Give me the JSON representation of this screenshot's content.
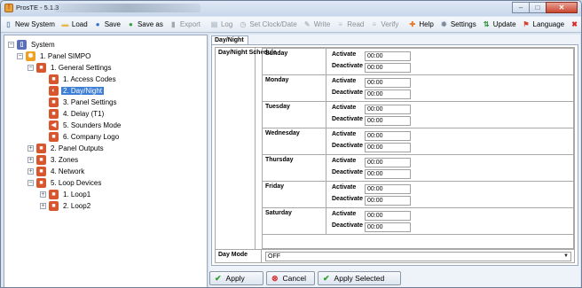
{
  "window": {
    "title": "ProsTE - 5.1.3",
    "controls": {
      "minimize": "–",
      "maximize": "□",
      "close": "✕"
    }
  },
  "toolbar": {
    "items": [
      {
        "label": "New System",
        "icon": "new-file-icon",
        "glyph": "▯",
        "color": "#6a87b6",
        "enabled": true
      },
      {
        "label": "Load",
        "icon": "folder-icon",
        "glyph": "▬",
        "color": "#e6b84a",
        "enabled": true
      },
      {
        "label": "Save",
        "icon": "save-disk-icon",
        "glyph": "●",
        "color": "#2c6fcf",
        "enabled": true
      },
      {
        "label": "Save as",
        "icon": "save-as-icon",
        "glyph": "●",
        "color": "#3a9f3a",
        "enabled": true
      },
      {
        "label": "Export",
        "icon": "export-chart-icon",
        "glyph": "▮",
        "color": "#a0a8b4",
        "enabled": false
      },
      {
        "label": "Log",
        "icon": "log-icon",
        "glyph": "▤",
        "color": "#b6bfcc",
        "enabled": false
      },
      {
        "label": "Set Clock/Date",
        "icon": "clock-icon",
        "glyph": "◷",
        "color": "#b6bfcc",
        "enabled": false
      },
      {
        "label": "Write",
        "icon": "pencil-icon",
        "glyph": "✎",
        "color": "#b6bfcc",
        "enabled": false
      },
      {
        "label": "Read",
        "icon": "read-icon",
        "glyph": "≡",
        "color": "#b6bfcc",
        "enabled": false
      },
      {
        "label": "Verify",
        "icon": "verify-icon",
        "glyph": "≡",
        "color": "#b6bfcc",
        "enabled": false
      },
      {
        "label": "Help",
        "icon": "help-lifebuoy-icon",
        "glyph": "✚",
        "color": "#e87a2c",
        "enabled": true
      },
      {
        "label": "Settings",
        "icon": "gear-icon",
        "glyph": "✹",
        "color": "#7a8a9a",
        "enabled": true
      },
      {
        "label": "Update",
        "icon": "update-arrows-icon",
        "glyph": "⇅",
        "color": "#2f8f3a",
        "enabled": true
      },
      {
        "label": "Language",
        "icon": "language-flag-icon",
        "glyph": "⚑",
        "color": "#d4442b",
        "enabled": true
      },
      {
        "label": "Exit",
        "icon": "exit-x-icon",
        "glyph": "✖",
        "color": "#d42b2b",
        "enabled": true
      }
    ]
  },
  "tree": {
    "nodes": [
      {
        "label": "System",
        "level": 0,
        "expander": "−",
        "icon": "system-book-icon",
        "color": "#5a6fb8",
        "glyph": "▯"
      },
      {
        "label": "1. Panel SIMPO",
        "level": 1,
        "expander": "−",
        "icon": "panel-sun-icon",
        "color": "#f0a020",
        "glyph": "✺"
      },
      {
        "label": "1. General Settings",
        "level": 2,
        "expander": "−",
        "icon": "general-settings-icon",
        "color": "#d8562e",
        "glyph": "■"
      },
      {
        "label": "1. Access Codes",
        "level": 3,
        "expander": "",
        "icon": "access-codes-icon",
        "color": "#d8562e",
        "glyph": "■"
      },
      {
        "label": "2. Day/Night",
        "level": 3,
        "expander": "",
        "icon": "day-night-icon",
        "color": "#d8562e",
        "glyph": "◐",
        "selected": true
      },
      {
        "label": "3. Panel Settings",
        "level": 3,
        "expander": "",
        "icon": "panel-settings-icon",
        "color": "#d8562e",
        "glyph": "■"
      },
      {
        "label": "4. Delay (T1)",
        "level": 3,
        "expander": "",
        "icon": "delay-icon",
        "color": "#d8562e",
        "glyph": "■"
      },
      {
        "label": "5. Sounders Mode",
        "level": 3,
        "expander": "",
        "icon": "sounders-icon",
        "color": "#d8562e",
        "glyph": "◀"
      },
      {
        "label": "6. Company Logo",
        "level": 3,
        "expander": "",
        "icon": "company-logo-icon",
        "color": "#d8562e",
        "glyph": "■"
      },
      {
        "label": "2. Panel Outputs",
        "level": 2,
        "expander": "+",
        "icon": "panel-outputs-icon",
        "color": "#d8562e",
        "glyph": "■"
      },
      {
        "label": "3. Zones",
        "level": 2,
        "expander": "+",
        "icon": "zones-icon",
        "color": "#d8562e",
        "glyph": "■"
      },
      {
        "label": "4. Network",
        "level": 2,
        "expander": "+",
        "icon": "network-icon",
        "color": "#d8562e",
        "glyph": "■"
      },
      {
        "label": "5. Loop Devices",
        "level": 2,
        "expander": "−",
        "icon": "loop-devices-icon",
        "color": "#d8562e",
        "glyph": "■"
      },
      {
        "label": "1. Loop1",
        "level": 3,
        "expander": "+",
        "icon": "loop-icon",
        "color": "#d8562e",
        "glyph": "■"
      },
      {
        "label": "2. Loop2",
        "level": 3,
        "expander": "+",
        "icon": "loop-icon",
        "color": "#d8562e",
        "glyph": "■"
      }
    ]
  },
  "tab": {
    "label": "Day/Night"
  },
  "schedule": {
    "label": "Day/Night Schedule",
    "activate_label": "Activate",
    "deactivate_label": "Deactivate",
    "days": [
      {
        "name": "Sunday",
        "activate": "00:00",
        "deactivate": "00:00"
      },
      {
        "name": "Monday",
        "activate": "00:00",
        "deactivate": "00:00"
      },
      {
        "name": "Tuesday",
        "activate": "00:00",
        "deactivate": "00:00"
      },
      {
        "name": "Wednesday",
        "activate": "00:00",
        "deactivate": "00:00"
      },
      {
        "name": "Thursday",
        "activate": "00:00",
        "deactivate": "00:00"
      },
      {
        "name": "Friday",
        "activate": "00:00",
        "deactivate": "00:00"
      },
      {
        "name": "Saturday",
        "activate": "00:00",
        "deactivate": "00:00"
      }
    ]
  },
  "day_mode": {
    "label": "Day Mode",
    "value": "OFF",
    "arrow": "▼"
  },
  "buttons": {
    "apply": {
      "label": "Apply",
      "icon": "checkmark-icon",
      "glyph": "✔",
      "color": "#2e9e2e"
    },
    "cancel": {
      "label": "Cancel",
      "icon": "cancel-icon",
      "glyph": "⊗",
      "color": "#d42b2b"
    },
    "apply_selected": {
      "label": "Apply Selected",
      "icon": "checkmark-icon",
      "glyph": "✔",
      "color": "#2e9e2e"
    }
  }
}
